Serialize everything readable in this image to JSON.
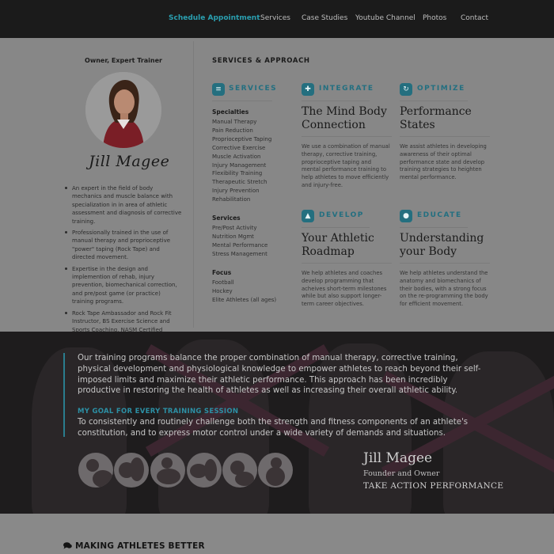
{
  "nav": {
    "items": [
      "Schedule Appointment",
      "Services",
      "Case Studies",
      "Youtube Channel",
      "Photos",
      "Contact"
    ],
    "active_index": 0
  },
  "profile": {
    "role": "Owner, Expert Trainer",
    "signature": "Jill Magee",
    "bio": [
      "An expert in the field of body mechanics and muscle balance with specialization in in area of athletic assessment and diagnosis of corrective training.",
      "Professionally trained in the use of manual therapy and proprioceptive \"power\" taping (Rock Tape) and directed movement.",
      "Expertise in the design and implemention of rehab, injury prevention, biomechanical correction, and pre/post game (or practice) training programs.",
      "Rock Tape Ambassador and Rock Fit Instructor, BS Exercise Science and Sports Coaching, NASM Certified Personal Trainer, Certified Massage Therapist"
    ]
  },
  "section_title": "SERVICES & APPROACH",
  "services": {
    "label": "SERVICES",
    "icon": "list-icon",
    "groups": [
      {
        "head": "Specialties",
        "items": [
          "Manual Therapy",
          "Pain Reduction",
          "Proprioceptive Taping",
          "Corrective Exercise",
          "Muscle Activation",
          "Injury Management",
          "Flexibility Training",
          "Therapeutic Stretch",
          "Injury Prevention",
          "Rehabilitation"
        ]
      },
      {
        "head": "Services",
        "items": [
          "Pre/Post Activity",
          "Nutrition Mgmt",
          "Mental Performance",
          "Stress Management"
        ]
      },
      {
        "head": "Focus",
        "items": [
          "Football",
          "Hockey",
          "Elite Athletes (all ages)"
        ]
      }
    ]
  },
  "cards": [
    {
      "label": "INTEGRATE",
      "icon": "puzzle-icon",
      "title": "The Mind Body Connection",
      "text": "We use a combination of manual therapy, corrective training, proprioceptive taping and mental performance training to help athletes to move efficiently and injury-free."
    },
    {
      "label": "OPTIMIZE",
      "icon": "refresh-icon",
      "title": "Performance States",
      "text": "We assist athletes in developing awareness of their optimal performance state and develop training strategies to heighten mental performance."
    },
    {
      "label": "DEVELOP",
      "icon": "road-icon",
      "title": "Your Athletic Roadmap",
      "text": "We help athletes and coaches develop programming that acheives short-term milestones while but also support longer-term career objectives."
    },
    {
      "label": "EDUCATE",
      "icon": "comments-icon",
      "title": "Understanding your Body",
      "text": "We help athletes understand the anatomy and biomechanics of their bodies, with a strong focus on the re-programming the body for efficient movement."
    }
  ],
  "band": {
    "paragraph": "Our training programs balance the proper combination of manual therapy, corrective training, physical development and physiological knowledge to empower athletes to reach beyond their self-imposed limits and maximize their athletic performance. This approach has been incredibly productive in restoring the health of athletes as well as increasing their overall athletic ability.",
    "goal_title": "MY GOAL FOR EVERY TRAINING SESSION",
    "goal_text": "To consistently and routinely challenge both the strength and fitness components of an athlete's constitution, and to express motor control under a wide variety of demands and situations.",
    "founder_name": "Jill Magee",
    "founder_role": "Founder and Owner",
    "founder_company": "TAKE ACTION PERFORMANCE"
  },
  "bottom": {
    "title": "MAKING ATHLETES BETTER",
    "icon": "comments-icon"
  },
  "colors": {
    "accent": "#2a9fb0",
    "accent_dark": "#246f7f",
    "nav_bg": "#1b1b1b",
    "panel_bg": "#878787",
    "band_bg": "#1e1c1d"
  }
}
